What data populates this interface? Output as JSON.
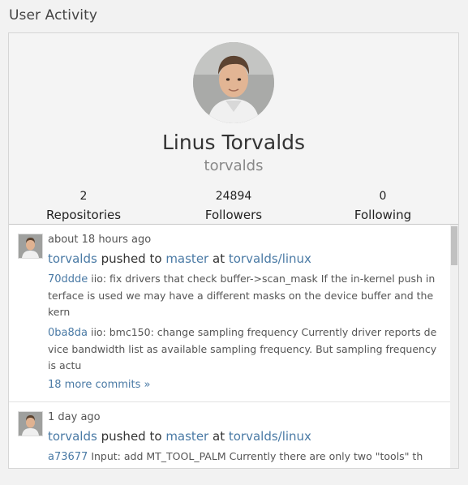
{
  "page": {
    "title": "User Activity"
  },
  "profile": {
    "name": "Linus Torvalds",
    "username": "torvalds",
    "stats": [
      {
        "value": "2",
        "label": "Repositories"
      },
      {
        "value": "24894",
        "label": "Followers"
      },
      {
        "value": "0",
        "label": "Following"
      }
    ]
  },
  "feed": {
    "events": [
      {
        "time": "about 18 hours ago",
        "user": "torvalds",
        "verb": "pushed to",
        "branch": "master",
        "preposition": "at",
        "repo": "torvalds/linux",
        "commits": [
          {
            "sha": "70ddde",
            "message": "iio: fix drivers that check buffer->scan_mask If the in-kernel push interface is used we may have a different masks on the device buffer and the kern"
          },
          {
            "sha": "0ba8da",
            "message": "iio: bmc150: change sampling frequency Currently driver reports device bandwidth list as available sampling frequency. But sampling frequency is actu"
          }
        ],
        "more": "18 more commits »"
      },
      {
        "time": "1 day ago",
        "user": "torvalds",
        "verb": "pushed to",
        "branch": "master",
        "preposition": "at",
        "repo": "torvalds/linux",
        "commits": [
          {
            "sha": "a73677",
            "message": "Input: add MT_TOOL_PALM Currently there are only two \"tools\" th"
          }
        ]
      }
    ]
  }
}
